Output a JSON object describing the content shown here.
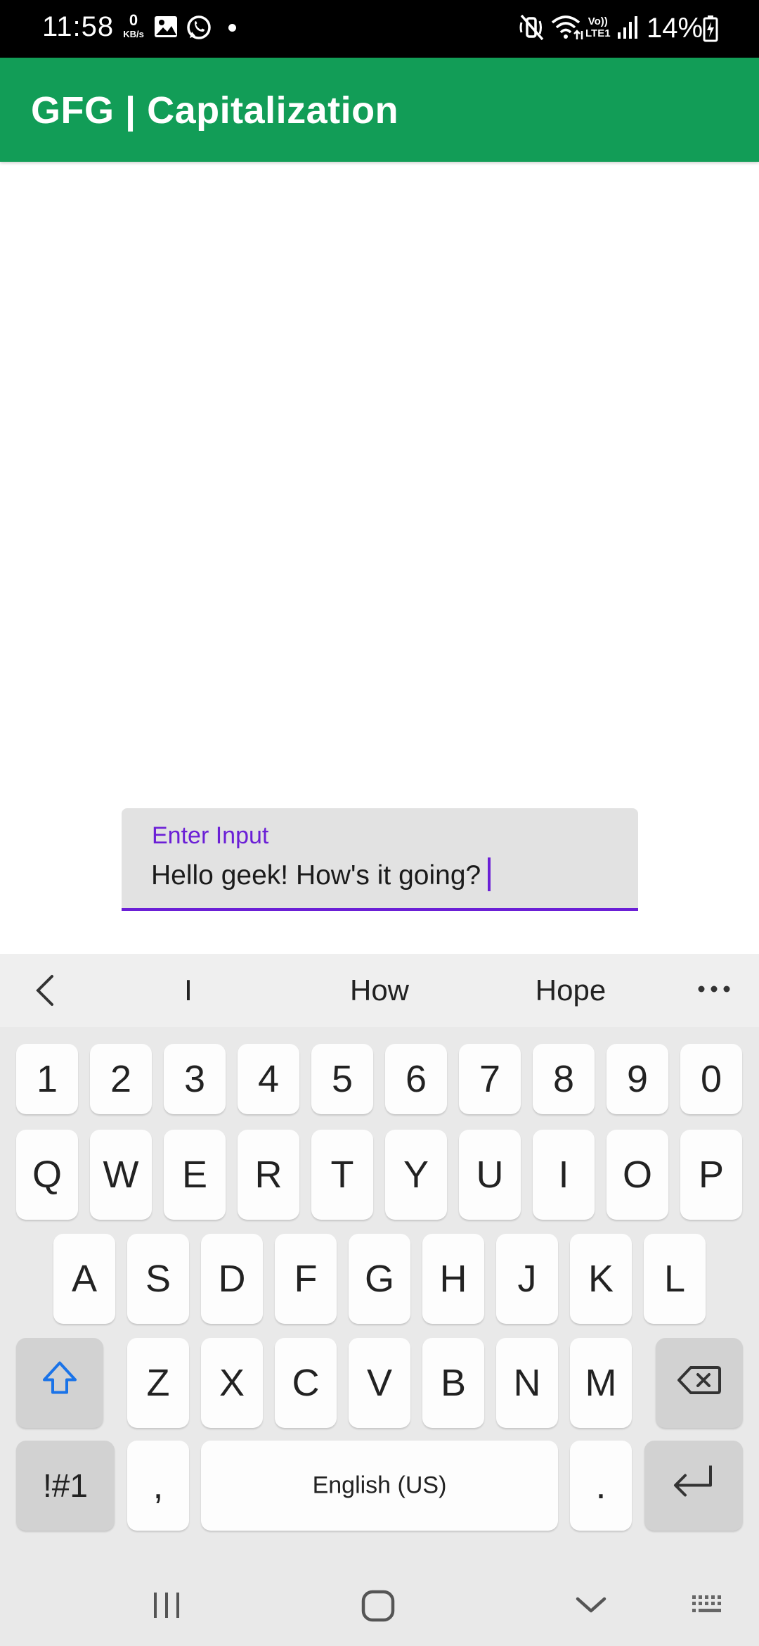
{
  "status_bar": {
    "time": "11:58",
    "net_speed_value": "0",
    "net_speed_unit": "KB/s",
    "volte_line1": "Vo))",
    "volte_line2": "LTE1",
    "battery_percent": "14%",
    "icons": [
      "gallery-icon",
      "whatsapp-icon",
      "notification-dot",
      "mute-icon",
      "wifi-icon",
      "signal-icon",
      "battery-charging-icon"
    ]
  },
  "app_bar": {
    "title": "GFG | Capitalization",
    "color": "#129d57"
  },
  "input": {
    "label": "Enter Input",
    "value": "Hello geek! How's it going?",
    "accent_color": "#6b1fd6"
  },
  "keyboard": {
    "suggestions": [
      "I",
      "How",
      "Hope"
    ],
    "number_row": [
      "1",
      "2",
      "3",
      "4",
      "5",
      "6",
      "7",
      "8",
      "9",
      "0"
    ],
    "row1": [
      "Q",
      "W",
      "E",
      "R",
      "T",
      "Y",
      "U",
      "I",
      "O",
      "P"
    ],
    "row2": [
      "A",
      "S",
      "D",
      "F",
      "G",
      "H",
      "J",
      "K",
      "L"
    ],
    "row3": [
      "Z",
      "X",
      "C",
      "V",
      "B",
      "N",
      "M"
    ],
    "symbols_key": "!#1",
    "comma_key": ",",
    "space_label": "English (US)",
    "period_key": ".",
    "shift_active_color": "#1a73e8"
  },
  "nav_bar": {
    "icons": [
      "recents-icon",
      "home-icon",
      "hide-keyboard-icon",
      "keyboard-switch-icon"
    ]
  }
}
